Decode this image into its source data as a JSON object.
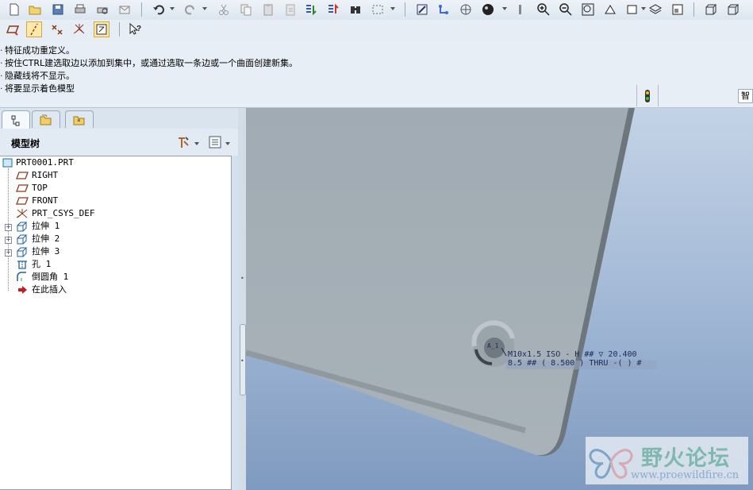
{
  "toolbar1": {
    "icons": [
      "new-file-icon",
      "open-folder-icon",
      "save-icon",
      "print-icon",
      "print-preview-icon",
      "email-icon",
      "undo-icon",
      "redo-icon",
      "cut-icon",
      "copy-icon",
      "paste-icon",
      "paste-special-icon",
      "regenerate-icon",
      "regenerate-manager-icon",
      "find-icon",
      "select-box-icon",
      "repaint-icon",
      "spin-center-icon",
      "orient-mode-icon",
      "shade-sphere-icon",
      "view-options-icon",
      "zoom-in-icon",
      "zoom-out-icon",
      "refit-icon",
      "reorient-icon",
      "saved-views-icon",
      "layers-icon",
      "view-manager-icon",
      "view-cube-icon",
      "view-cube-2-icon"
    ]
  },
  "toolbar2": {
    "icons": [
      "datum-plane-display-icon",
      "datum-axis-display-icon",
      "datum-point-display-icon",
      "coord-sys-display-icon",
      "annotation-display-icon",
      "context-help-icon"
    ]
  },
  "messages": [
    "特征成功重定义。",
    "按住CTRL建选取边以添加到集中，或通过选取一条边或一个曲面创建新集。",
    "隐藏线将不显示。",
    "将要显示着色模型"
  ],
  "right_button_label": "智",
  "model_tree": {
    "title": "模型树",
    "tabs": [
      "model-tree-tab",
      "folder-browser-tab",
      "favorites-tab"
    ],
    "root": "PRT0001.PRT",
    "items": [
      {
        "label": "RIGHT",
        "icon": "datum-plane-icon",
        "expandable": false
      },
      {
        "label": "TOP",
        "icon": "datum-plane-icon",
        "expandable": false
      },
      {
        "label": "FRONT",
        "icon": "datum-plane-icon",
        "expandable": false
      },
      {
        "label": "PRT_CSYS_DEF",
        "icon": "coordinate-system-icon",
        "expandable": false
      },
      {
        "label": "拉伸 1",
        "icon": "extrude-icon",
        "expandable": true
      },
      {
        "label": "拉伸 2",
        "icon": "extrude-icon",
        "expandable": true
      },
      {
        "label": "拉伸 3",
        "icon": "extrude-icon",
        "expandable": true
      },
      {
        "label": "孔 1",
        "icon": "hole-icon",
        "expandable": false
      },
      {
        "label": "倒圆角 1",
        "icon": "round-icon",
        "expandable": false
      },
      {
        "label": "在此插入",
        "icon": "insert-here-arrow-icon",
        "expandable": false
      }
    ]
  },
  "annotation": {
    "line1": "M10x1.5 ISO - H ## ▽ 20.400",
    "line2": "8.5 ## ( 8.500 )  THRU  -( ) #",
    "axis_label": "A_1"
  },
  "watermark": {
    "title": "野火论坛",
    "url": "www.proewildfire.cn"
  },
  "colors": {
    "toolbar_bg": "#e3ebf3",
    "part_surface": "#a4aeb5",
    "viewport_bg": "#9fb6d4",
    "annotation_text": "#1d2a5e"
  }
}
